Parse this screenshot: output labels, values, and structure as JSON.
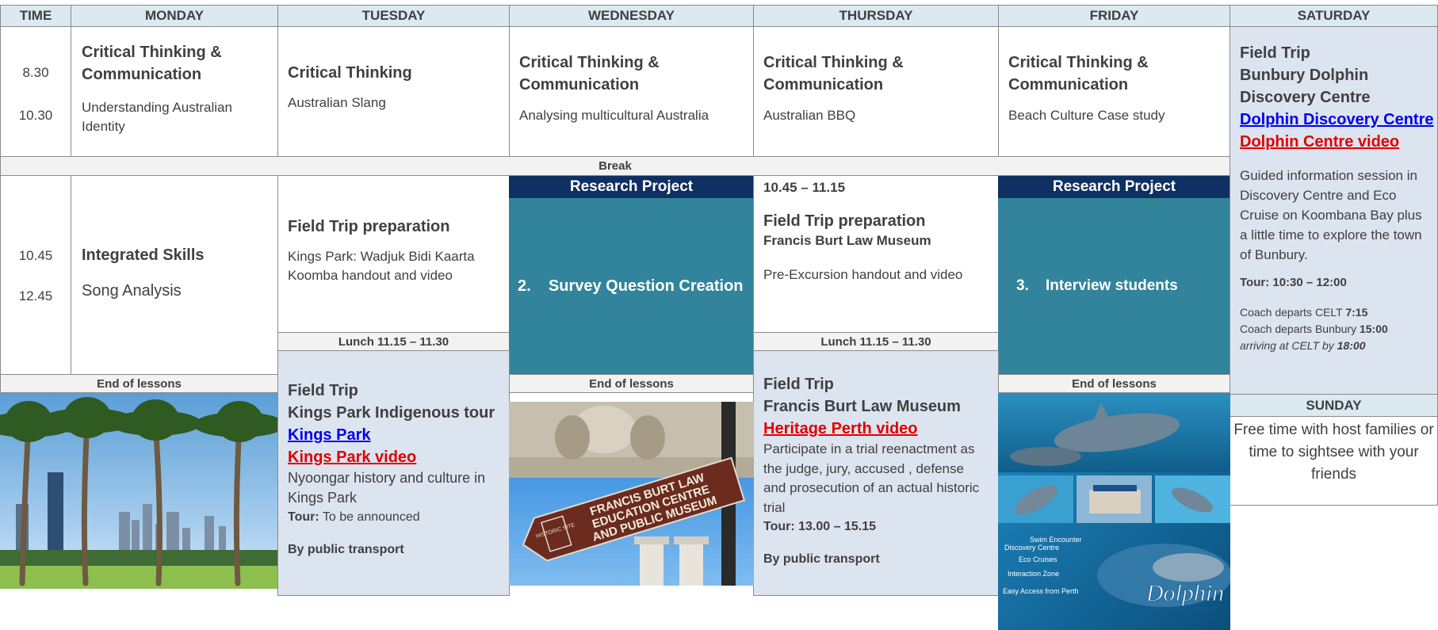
{
  "headers": {
    "time": "TIME",
    "monday": "MONDAY",
    "tuesday": "TUESDAY",
    "wednesday": "WEDNESDAY",
    "thursday": "THURSDAY",
    "friday": "FRIDAY",
    "saturday": "SATURDAY"
  },
  "session1": {
    "start": "8.30",
    "end": "10.30",
    "monday": {
      "title": "Critical Thinking & Communication",
      "topic": "Understanding Australian Identity"
    },
    "tuesday": {
      "title": "Critical Thinking",
      "topic": "Australian Slang"
    },
    "wednesday": {
      "title": "Critical Thinking & Communication",
      "topic": "Analysing multicultural Australia"
    },
    "thursday": {
      "title": "Critical Thinking & Communication",
      "topic": "Australian BBQ"
    },
    "friday": {
      "title": "Critical Thinking & Communication",
      "topic": "Beach Culture Case study"
    }
  },
  "break_label": "Break",
  "session2": {
    "start": "10.45",
    "end": "12.45",
    "monday": {
      "title": "Integrated Skills",
      "topic": "Song Analysis"
    },
    "tuesday": {
      "title": "Field Trip preparation",
      "topic": "Kings Park: Wadjuk Bidi Kaarta Koomba handout and video"
    },
    "wednesday": {
      "header": "Research Project",
      "task": "2.    Survey Question Creation"
    },
    "thursday": {
      "time": "10.45 – 11.15",
      "title": "Field Trip preparation",
      "subtitle": "Francis Burt Law Museum",
      "topic": "Pre-Excursion handout and video"
    },
    "friday": {
      "header": "Research Project",
      "task": "3.    Interview students"
    }
  },
  "lunch_label": "Lunch 11.15 – 11.30",
  "end_of_lessons_label": "End of lessons",
  "tuesday_trip": {
    "line1": "Field Trip",
    "line2": "Kings Park Indigenous tour",
    "link1": "Kings Park",
    "link2": "Kings Park video",
    "desc": "Nyoongar history and culture in Kings Park",
    "tour_label": "Tour:",
    "tour_value": "To be announced",
    "transport": "By public transport"
  },
  "thursday_trip": {
    "line1": "Field Trip",
    "line2": "Francis Burt Law Museum",
    "link1": "Heritage Perth video",
    "desc": "Participate in a trial reenactment as the judge, jury, accused , defense and prosecution of an actual historic trial",
    "tour": "Tour:  13.00 – 15.15",
    "transport": "By public transport"
  },
  "saturday": {
    "line1": "Field Trip",
    "line2": "Bunbury Dolphin",
    "line3": "Discovery Centre",
    "link1": "Dolphin Discovery Centre",
    "link2": "Dolphin Centre video",
    "desc": "Guided information session in Discovery Centre and Eco Cruise on Koombana Bay plus a little time to explore the town of Bunbury.",
    "tour": "Tour:  10:30 – 12:00",
    "coach1_text": "Coach departs CELT ",
    "coach1_time": "7:15",
    "coach2_text": "Coach departs Bunbury  ",
    "coach2_time": "15:00",
    "arrive_text": "arriving at CELT by ",
    "arrive_time": "18:00"
  },
  "sunday": {
    "header": "SUNDAY",
    "text": "Free time with host families or time to sightsee with your friends"
  },
  "images": {
    "sign_line1": "FRANCIS BURT LAW",
    "sign_line2": "EDUCATION CENTRE",
    "sign_line3": "AND PUBLIC MUSEUM",
    "sign_badge": "HISTORIC SITE",
    "dolphin_list": [
      "Swim Encounter",
      "Discovery Centre",
      "Eco Cruises",
      "Interaction Zone",
      "Easy Access from Perth"
    ],
    "dolphin_logo": "Dolphin",
    "dolphin_logo_sub": "DISCOVERY CENTRE"
  },
  "colors": {
    "header_bg": "#dbe9f1",
    "navy": "#0f3063",
    "teal": "#31849b",
    "light_blue": "#dce4ef",
    "link_blue": "#0000ee",
    "link_red": "#e00000"
  }
}
